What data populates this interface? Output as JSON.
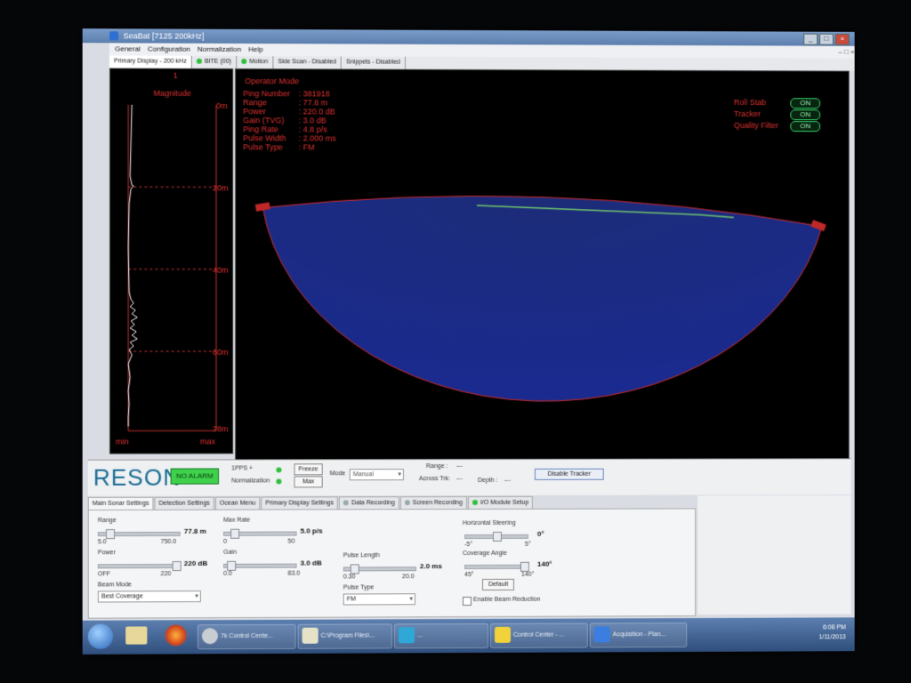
{
  "window": {
    "title": "SeaBat   [7125 200kHz]"
  },
  "menu": [
    "General",
    "Configuration",
    "Normalization",
    "Help"
  ],
  "display_tabs": [
    {
      "label": "Primary Display - 200 kHz",
      "led": false
    },
    {
      "label": "BITE (00)",
      "led": true
    },
    {
      "label": "Motion",
      "led": true
    },
    {
      "label": "Side Scan - Disabled",
      "led": false
    },
    {
      "label": "Snippets - Disabled",
      "led": false
    }
  ],
  "magnitude": {
    "index_label": "1",
    "title": "Magnitude",
    "depths": [
      "0m",
      "20m",
      "40m",
      "60m",
      "78m"
    ],
    "min_label": "min",
    "max_label": "max"
  },
  "operator": {
    "mode_label": "Operator Mode",
    "fields": [
      {
        "label": "Ping Number",
        "value": ": 381918"
      },
      {
        "label": "Range",
        "value": ": 77.8 m"
      },
      {
        "label": "Power",
        "value": ": 220.0 dB"
      },
      {
        "label": "Gain (TVG)",
        "value": ": 3.0 dB"
      },
      {
        "label": "Ping Rate",
        "value": ": 4.8 p/s"
      },
      {
        "label": "Pulse Width",
        "value": ": 2.000 ms"
      },
      {
        "label": "Pulse Type",
        "value": ": FM"
      }
    ]
  },
  "status_flags": [
    {
      "label": "Roll Stab",
      "value": "ON"
    },
    {
      "label": "Tracker",
      "value": "ON"
    },
    {
      "label": "Quality Filter",
      "value": "ON"
    }
  ],
  "statusbar": {
    "brand": "RESON",
    "alarm": "NO ALARM",
    "pps_label": "1PPS +",
    "norm_label": "Normalization",
    "freeze": "Freeze",
    "max": "Max",
    "mode_label": "Mode",
    "mode_value": "Manual",
    "range_label": "Range :",
    "range_value": "---",
    "across_label": "Across Trk:",
    "across_value": "---",
    "depth_label": "Depth :",
    "depth_value": "---",
    "tracker_btn": "Disable Tracker"
  },
  "settings_tabs": [
    {
      "label": "Main Sonar Settings",
      "led": false
    },
    {
      "label": "Detection Settings",
      "led": false
    },
    {
      "label": "Ocean Menu",
      "led": false
    },
    {
      "label": "Primary Display Settings",
      "led": false
    },
    {
      "label": "Data Recording",
      "led": true
    },
    {
      "label": "Screen Recording",
      "led": true
    },
    {
      "label": "I/O Module Setup",
      "led": true
    }
  ],
  "settings": {
    "range": {
      "label": "Range",
      "value": "77.8 m",
      "min": "5.0",
      "max": "750.0",
      "level": 0.1
    },
    "max_rate": {
      "label": "Max Rate",
      "value": "5.0 p/s",
      "min": "0",
      "max": "50",
      "level": 0.1
    },
    "power": {
      "label": "Power",
      "value": "220 dB",
      "min": "OFF",
      "max": "220",
      "level": 1.0
    },
    "gain": {
      "label": "Gain",
      "value": "3.0 dB",
      "min": "0.0",
      "max": "83.0",
      "level": 0.04
    },
    "pulse_length": {
      "label": "Pulse Length",
      "value": "2.0 ms",
      "min": "0.30",
      "max": "20.0",
      "level": 0.1
    },
    "beam_mode": {
      "label": "Beam Mode",
      "value": "Best Coverage"
    },
    "pulse_type": {
      "label": "Pulse Type",
      "value": "FM"
    },
    "h_steering": {
      "label": "Horizontal Steering",
      "value": "0°",
      "min": "-5°",
      "max": "5°",
      "level": 0.5
    },
    "coverage": {
      "label": "Coverage Angle",
      "value": "140°",
      "min": "45°",
      "max": "140°",
      "level": 1.0
    },
    "default_btn": "Default",
    "beam_reduction": "Enable Beam Reduction"
  },
  "taskbar": {
    "items": [
      {
        "label": "7k Control Cente..."
      },
      {
        "label": "C:\\Program Files\\..."
      },
      {
        "label": "..."
      },
      {
        "label": "Control Center - ..."
      },
      {
        "label": "Acquisition - Plan..."
      }
    ],
    "time": "6:08 PM",
    "date": "1/11/2013"
  }
}
